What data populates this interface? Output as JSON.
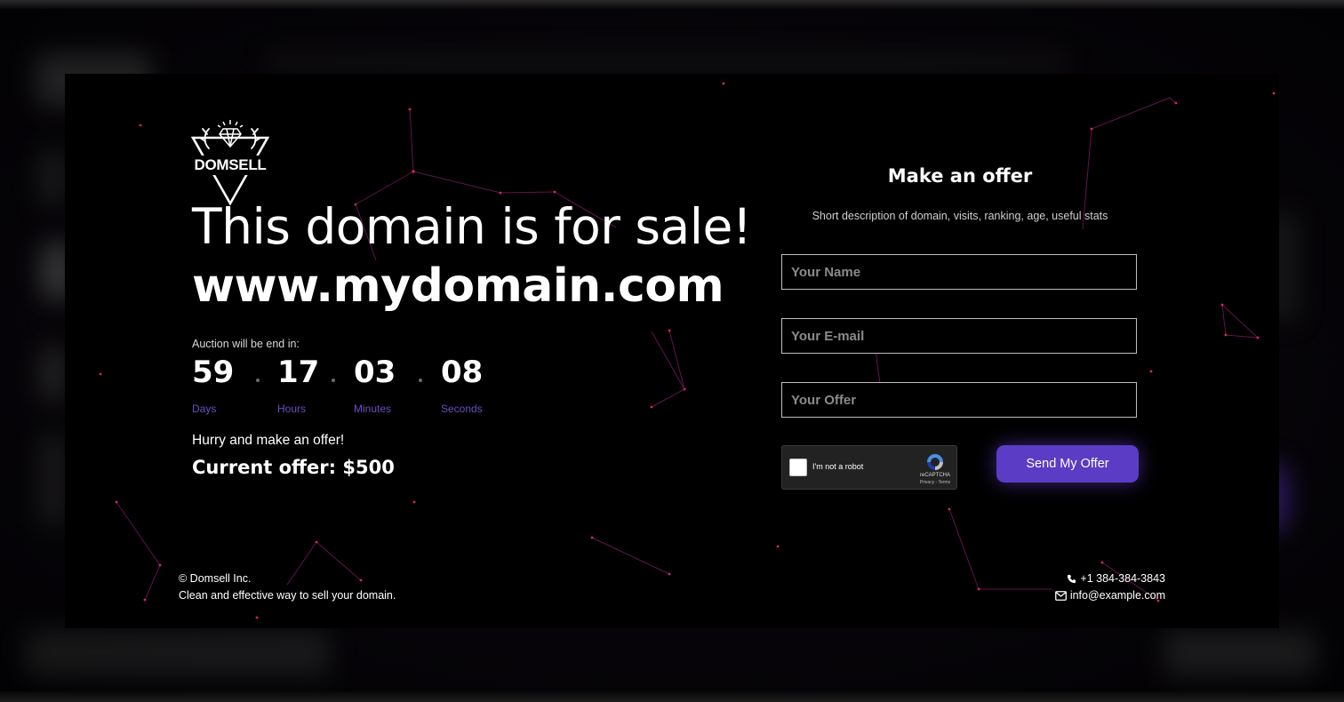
{
  "brand": {
    "logo_text": "DOMSELL"
  },
  "hero": {
    "headline": "This domain is for sale!",
    "domain": "www.mydomain.com"
  },
  "countdown": {
    "label": "Auction will be end in:",
    "units": [
      {
        "value": "59",
        "unit": "Days"
      },
      {
        "value": "17",
        "unit": "Hours"
      },
      {
        "value": "03",
        "unit": "Minutes"
      },
      {
        "value": "08",
        "unit": "Seconds"
      }
    ]
  },
  "offer": {
    "hurry_text": "Hurry and make an offer!",
    "current_offer": "Current offer: $500"
  },
  "form": {
    "title": "Make an offer",
    "description": "Short description of domain, visits, ranking, age, useful stats",
    "name_placeholder": "Your Name",
    "email_placeholder": "Your E-mail",
    "offer_placeholder": "Your Offer",
    "captcha_label": "I'm not a robot",
    "captcha_brand": "reCAPTCHA",
    "captcha_terms": "Privacy - Terms",
    "submit_label": "Send My Offer"
  },
  "footer": {
    "company": "© Domsell Inc.",
    "tagline": "Clean and effective way to sell your domain.",
    "phone": "+1 384-384-3843",
    "email": "info@example.com"
  },
  "colors": {
    "accent": "#5b3cc4",
    "countdown_unit": "#6a4fc0",
    "background": "#000000",
    "network_line": "#8a1f6e",
    "network_dot": "#e0206a"
  },
  "icons": [
    "diamond-icon",
    "antlers-icon",
    "phone-icon",
    "envelope-icon",
    "recaptcha-icon"
  ]
}
